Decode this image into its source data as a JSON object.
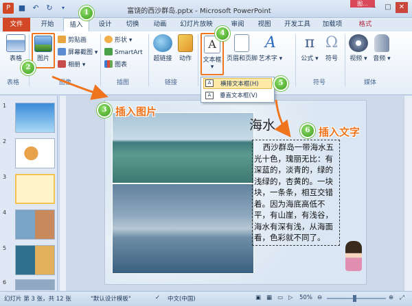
{
  "window": {
    "title": "富饶的西沙群岛.pptx - Microsoft PowerPoint",
    "context_tab_group": "图..."
  },
  "tabs": [
    {
      "label": "文件"
    },
    {
      "label": "开始"
    },
    {
      "label": "插入"
    },
    {
      "label": "设计"
    },
    {
      "label": "切换"
    },
    {
      "label": "动画"
    },
    {
      "label": "幻灯片放映"
    },
    {
      "label": "审阅"
    },
    {
      "label": "视图"
    },
    {
      "label": "开发工具"
    },
    {
      "label": "加载项"
    },
    {
      "label": "格式"
    }
  ],
  "ribbon": {
    "table": "表格",
    "picture": "图片",
    "clipart": "剪贴画",
    "screenshot": "屏幕截图",
    "album": "相册",
    "shapes": "形状",
    "smartart": "SmartArt",
    "chart": "图表",
    "hyperlink": "超链接",
    "action": "动作",
    "textbox": "文本框",
    "header_footer": "页眉和页脚",
    "wordart": "艺术字",
    "equation": "公式",
    "symbol": "符号",
    "video": "视频",
    "audio": "音频",
    "groups": {
      "tables": "表格",
      "images": "图像",
      "illustrations": "插图",
      "links": "链接",
      "symbols": "符号",
      "media": "媒体"
    }
  },
  "dropdown": {
    "horizontal": "横排文本框(H)",
    "vertical": "垂直文本框(V)"
  },
  "slides": [
    {
      "num": "1"
    },
    {
      "num": "2"
    },
    {
      "num": "3"
    },
    {
      "num": "4"
    },
    {
      "num": "5"
    },
    {
      "num": "6"
    }
  ],
  "slide": {
    "heading": "海水",
    "body": "西沙群岛一带海水五光十色，瑰丽无比：有深蓝的，淡青的，绿的浅绿的，杏黄的。一块块，一条条，相互交错着。因为海底高低不平，有山崖，有浅谷，海水有深有浅，从海面看，色彩就不同了。"
  },
  "annotations": {
    "b1": "1",
    "b2": "2",
    "b3": "3",
    "b4": "4",
    "b5": "5",
    "b6": "6",
    "insert_picture": "插入图片",
    "insert_text": "插入文字"
  },
  "status": {
    "slide_info": "幻灯片 第 3 张，共 12 张",
    "theme": "\"默认设计模板\"",
    "language": "中文(中国)",
    "zoom": "50%"
  }
}
